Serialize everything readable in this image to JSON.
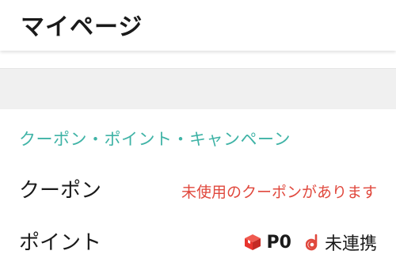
{
  "header": {
    "title": "マイページ"
  },
  "cut_text": "[ ] · ¬ · ¬",
  "section": {
    "title": "クーポン・ポイント・キャンペーン"
  },
  "rows": {
    "coupon": {
      "label": "クーポン",
      "status": "未使用のクーポンがあります"
    },
    "point": {
      "label": "ポイント",
      "value": "P0",
      "link_status": "未連携"
    }
  },
  "icons": {
    "point_box": "red-box-icon",
    "d_point": "d-point-icon"
  },
  "colors": {
    "accent_teal": "#3fb3a6",
    "alert_red": "#e0483d",
    "box_red": "#e8352e"
  }
}
